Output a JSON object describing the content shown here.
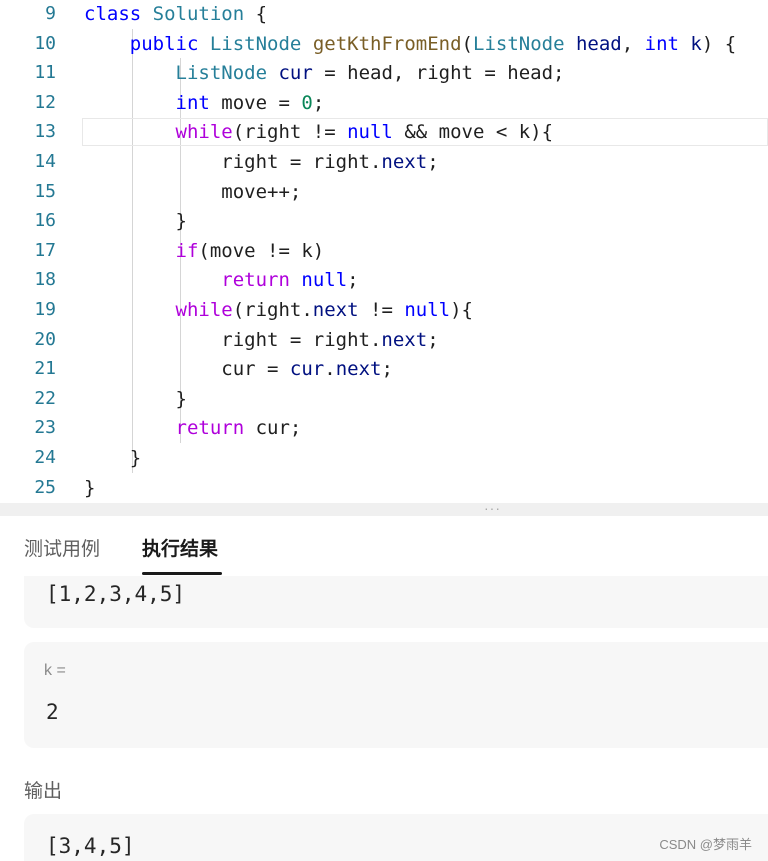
{
  "editor": {
    "lines": [
      {
        "n": "9",
        "tokens": [
          {
            "t": "class",
            "c": "kw-c"
          },
          {
            "t": " "
          },
          {
            "t": "Solution",
            "c": "ty"
          },
          {
            "t": " {"
          }
        ]
      },
      {
        "n": "10",
        "indent": 1,
        "tokens": [
          {
            "t": "    "
          },
          {
            "t": "public",
            "c": "kw-c"
          },
          {
            "t": " "
          },
          {
            "t": "ListNode",
            "c": "ty"
          },
          {
            "t": " "
          },
          {
            "t": "getKthFromEnd",
            "c": "fn"
          },
          {
            "t": "("
          },
          {
            "t": "ListNode",
            "c": "ty"
          },
          {
            "t": " "
          },
          {
            "t": "head",
            "c": "pr"
          },
          {
            "t": ", "
          },
          {
            "t": "int",
            "c": "kw-c"
          },
          {
            "t": " "
          },
          {
            "t": "k",
            "c": "pr"
          },
          {
            "t": ") {"
          }
        ]
      },
      {
        "n": "11",
        "tokens": [
          {
            "t": "        "
          },
          {
            "t": "ListNode",
            "c": "ty"
          },
          {
            "t": " "
          },
          {
            "t": "cur",
            "c": "pr"
          },
          {
            "t": " = head, right = head;"
          }
        ]
      },
      {
        "n": "12",
        "tokens": [
          {
            "t": "        "
          },
          {
            "t": "int",
            "c": "kw-c"
          },
          {
            "t": " move = "
          },
          {
            "t": "0",
            "c": "nm"
          },
          {
            "t": ";"
          }
        ]
      },
      {
        "n": "13",
        "current": true,
        "tokens": [
          {
            "t": "        "
          },
          {
            "t": "while",
            "c": "kw-f"
          },
          {
            "t": "(right != "
          },
          {
            "t": "null",
            "c": "kw-c"
          },
          {
            "t": " && move < k){"
          }
        ]
      },
      {
        "n": "14",
        "tokens": [
          {
            "t": "            right = right."
          },
          {
            "t": "next",
            "c": "pr"
          },
          {
            "t": ";"
          }
        ]
      },
      {
        "n": "15",
        "tokens": [
          {
            "t": "            move++;"
          }
        ]
      },
      {
        "n": "16",
        "tokens": [
          {
            "t": "        }"
          }
        ]
      },
      {
        "n": "17",
        "tokens": [
          {
            "t": "        "
          },
          {
            "t": "if",
            "c": "kw-f"
          },
          {
            "t": "(move != k)"
          }
        ]
      },
      {
        "n": "18",
        "tokens": [
          {
            "t": "            "
          },
          {
            "t": "return",
            "c": "kw-f"
          },
          {
            "t": " "
          },
          {
            "t": "null",
            "c": "kw-c"
          },
          {
            "t": ";"
          }
        ]
      },
      {
        "n": "19",
        "tokens": [
          {
            "t": "        "
          },
          {
            "t": "while",
            "c": "kw-f"
          },
          {
            "t": "(right."
          },
          {
            "t": "next",
            "c": "pr"
          },
          {
            "t": " != "
          },
          {
            "t": "null",
            "c": "kw-c"
          },
          {
            "t": "){"
          }
        ]
      },
      {
        "n": "20",
        "tokens": [
          {
            "t": "            right = right."
          },
          {
            "t": "next",
            "c": "pr"
          },
          {
            "t": ";"
          }
        ]
      },
      {
        "n": "21",
        "tokens": [
          {
            "t": "            cur = "
          },
          {
            "t": "cur",
            "c": "pr"
          },
          {
            "t": "."
          },
          {
            "t": "next",
            "c": "pr"
          },
          {
            "t": ";"
          }
        ]
      },
      {
        "n": "22",
        "tokens": [
          {
            "t": "        }"
          }
        ]
      },
      {
        "n": "23",
        "tokens": [
          {
            "t": "        "
          },
          {
            "t": "return",
            "c": "kw-f"
          },
          {
            "t": " cur;"
          }
        ]
      },
      {
        "n": "24",
        "tokens": [
          {
            "t": "    }"
          }
        ]
      },
      {
        "n": "25",
        "tokens": [
          {
            "t": "}"
          }
        ]
      }
    ]
  },
  "splitter": {
    "handle": "···"
  },
  "tabs": {
    "test_cases": "测试用例",
    "result": "执行结果",
    "active": "result"
  },
  "result": {
    "input_head_value": "[1,2,3,4,5]",
    "k_label": "k =",
    "k_value": "2",
    "output_label": "输出",
    "output_value": "[3,4,5]"
  },
  "watermark": "CSDN @梦雨羊",
  "colors": {
    "line_number": "#237893",
    "keyword": "#0000ff",
    "control": "#af00db",
    "type": "#267f99",
    "function": "#795e26",
    "property": "#001080",
    "number": "#098658"
  }
}
